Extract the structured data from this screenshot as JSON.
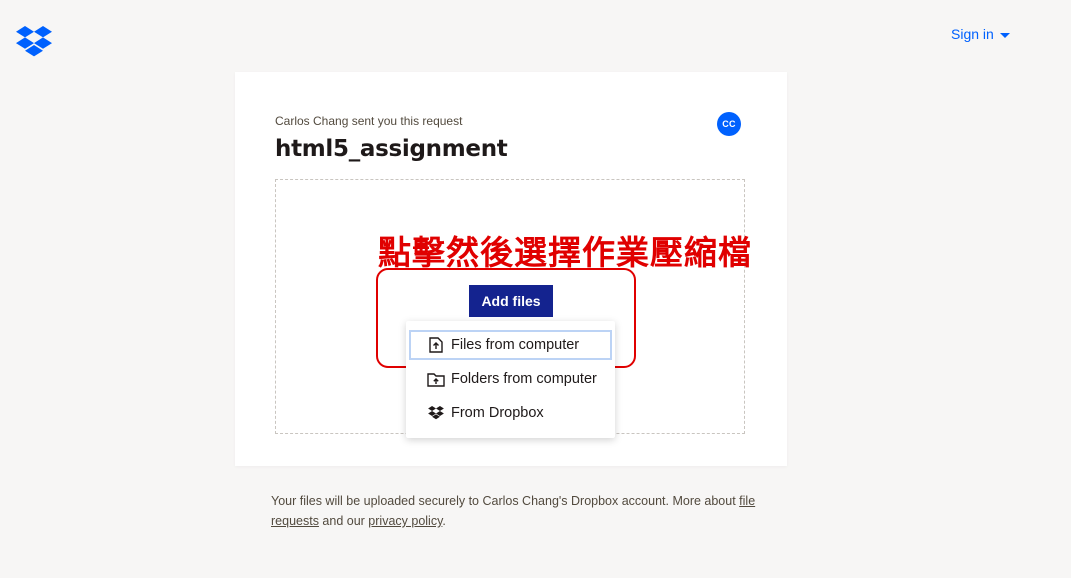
{
  "header": {
    "logo_icon": "dropbox-logo-icon",
    "brand_color": "#0061fe",
    "sign_in_label": "Sign in"
  },
  "request": {
    "requester_line": "Carlos Chang sent you this request",
    "avatar_initials": "CC",
    "title": "html5_assignment"
  },
  "annotation": {
    "text": "點擊然後選擇作業壓縮檔",
    "color": "#e00000"
  },
  "upload": {
    "add_files_label": "Add files",
    "button_color": "#14238f",
    "menu_items": [
      {
        "label": "Files from computer",
        "icon": "file-upload-icon",
        "selected": true
      },
      {
        "label": "Folders from computer",
        "icon": "folder-upload-icon",
        "selected": false
      },
      {
        "label": "From Dropbox",
        "icon": "dropbox-icon",
        "selected": false
      }
    ]
  },
  "footer": {
    "text_before": "Your files will be uploaded securely to Carlos Chang's Dropbox account. More about ",
    "file_requests_link": "file requests",
    "text_middle": " and our ",
    "privacy_link": "privacy policy",
    "text_after": "."
  }
}
